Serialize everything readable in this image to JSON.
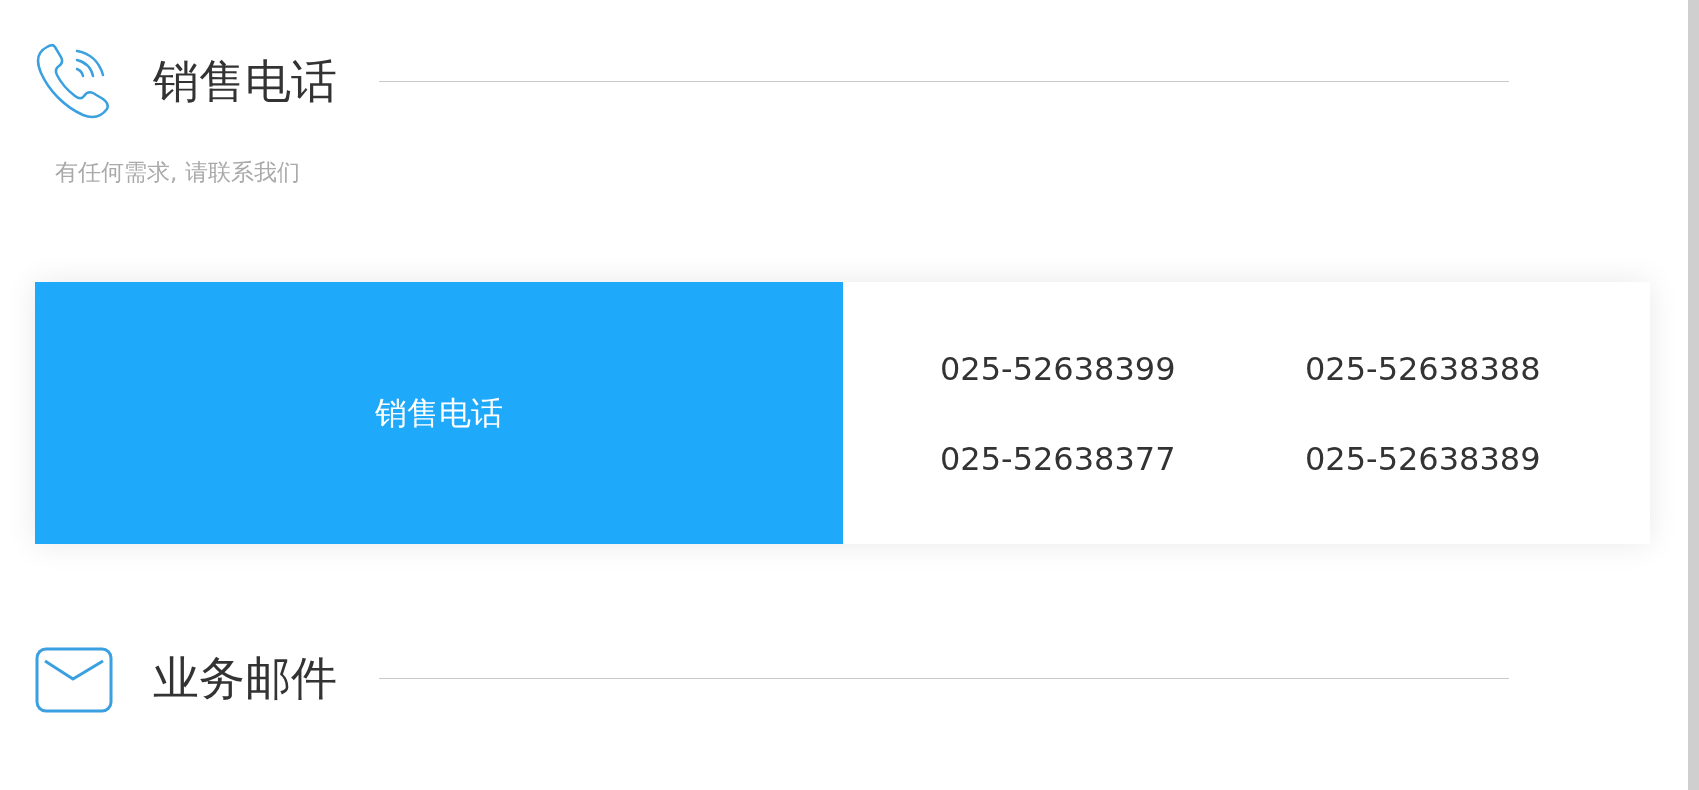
{
  "sections": [
    {
      "kind": "phone",
      "title": "销售电话",
      "subtitle": "有任何需求, 请联系我们",
      "card": {
        "label": "销售电话",
        "numbers": [
          "025-52638399",
          "025-52638388",
          "025-52638377",
          "025-52638389"
        ]
      }
    },
    {
      "kind": "mail",
      "title": "业务邮件"
    }
  ]
}
